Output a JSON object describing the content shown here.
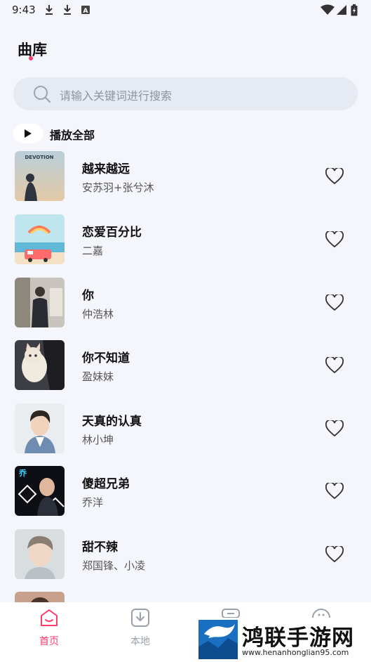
{
  "status_bar": {
    "time": "9:43",
    "icons": [
      "download-icon",
      "download-icon",
      "font-a-icon",
      "wifi-icon",
      "signal-icon",
      "battery-icon"
    ]
  },
  "header": {
    "title": "曲库",
    "accent_color": "#ff3b6b"
  },
  "search": {
    "placeholder": "请输入关键词进行搜索"
  },
  "play_all": {
    "label": "播放全部"
  },
  "songs": [
    {
      "title": "越来越远",
      "artist": "安苏羽+张兮沐",
      "cover_text": "DEVOTION"
    },
    {
      "title": "恋爱百分比",
      "artist": "二嘉"
    },
    {
      "title": "你",
      "artist": "仲浩林"
    },
    {
      "title": "你不知道",
      "artist": "盈妹妹"
    },
    {
      "title": "天真的认真",
      "artist": "林小坤"
    },
    {
      "title": "傻超兄弟",
      "artist": "乔洋"
    },
    {
      "title": "甜不辣",
      "artist": "郑国锋、小凌"
    }
  ],
  "bottom_nav": {
    "items": [
      {
        "label": "首页",
        "active": true
      },
      {
        "label": "本地",
        "active": false
      }
    ],
    "active_color": "#ff3b6b",
    "inactive_color": "#9aa0ab"
  },
  "watermark": {
    "title": "鸿联手游网",
    "url": "www.henanhonglian95.com"
  }
}
